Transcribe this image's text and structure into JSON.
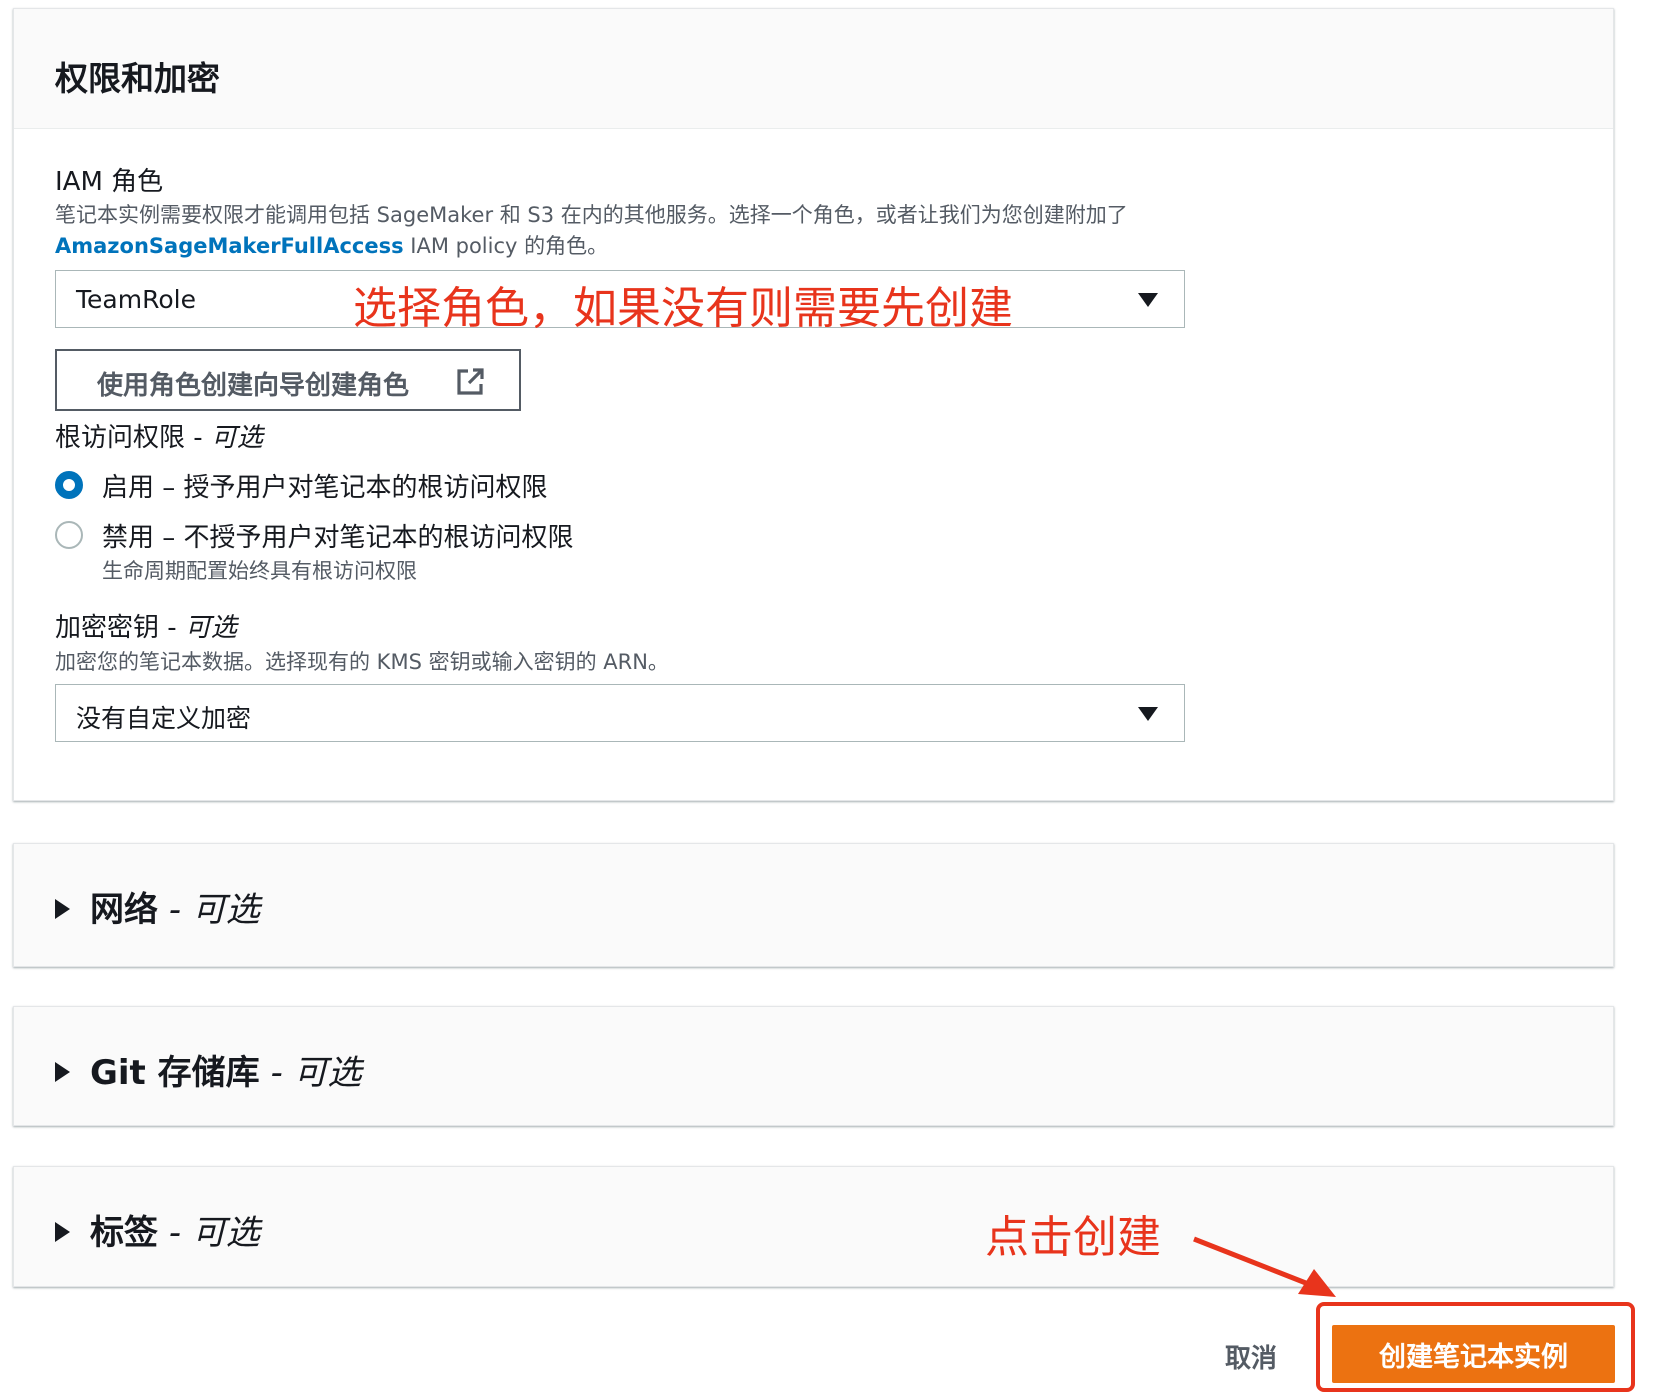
{
  "permissions_section": {
    "title": "权限和加密",
    "iam_role": {
      "label": "IAM 角色",
      "description_line1": "笔记本实例需要权限才能调用包括 SageMaker 和 S3 在内的其他服务。选择一个角色，或者让我们为您创建附加了",
      "policy_link": "AmazonSageMakerFullAccess",
      "description_line2_suffix": " IAM policy 的角色。",
      "selected_value": "TeamRole",
      "annotation": "选择角色，如果没有则需要先创建",
      "wizard_button_label": "使用角色创建向导创建角色"
    },
    "root_access": {
      "label": "根访问权限 - ",
      "optional": "可选",
      "options": [
        {
          "label": "启用 – 授予用户对笔记本的根访问权限",
          "selected": true
        },
        {
          "label": "禁用 – 不授予用户对笔记本的根访问权限",
          "selected": false
        }
      ],
      "note": "生命周期配置始终具有根访问权限"
    },
    "encryption_key": {
      "label": "加密密钥 - ",
      "optional": "可选",
      "description": "加密您的笔记本数据。选择现有的 KMS 密钥或输入密钥的 ARN。",
      "selected_value": "没有自定义加密"
    }
  },
  "collapsed_sections": [
    {
      "title": "网络",
      "suffix": " - ",
      "optional": "可选"
    },
    {
      "title": "Git 存储库",
      "suffix": " - ",
      "optional": "可选"
    },
    {
      "title": "标签",
      "suffix": " - ",
      "optional": "可选"
    }
  ],
  "footer": {
    "cancel_label": "取消",
    "create_label": "创建笔记本实例",
    "annotation": "点击创建"
  },
  "colors": {
    "primary_button": "#ec7211",
    "link": "#0073bb",
    "annotation": "#e8341c"
  }
}
